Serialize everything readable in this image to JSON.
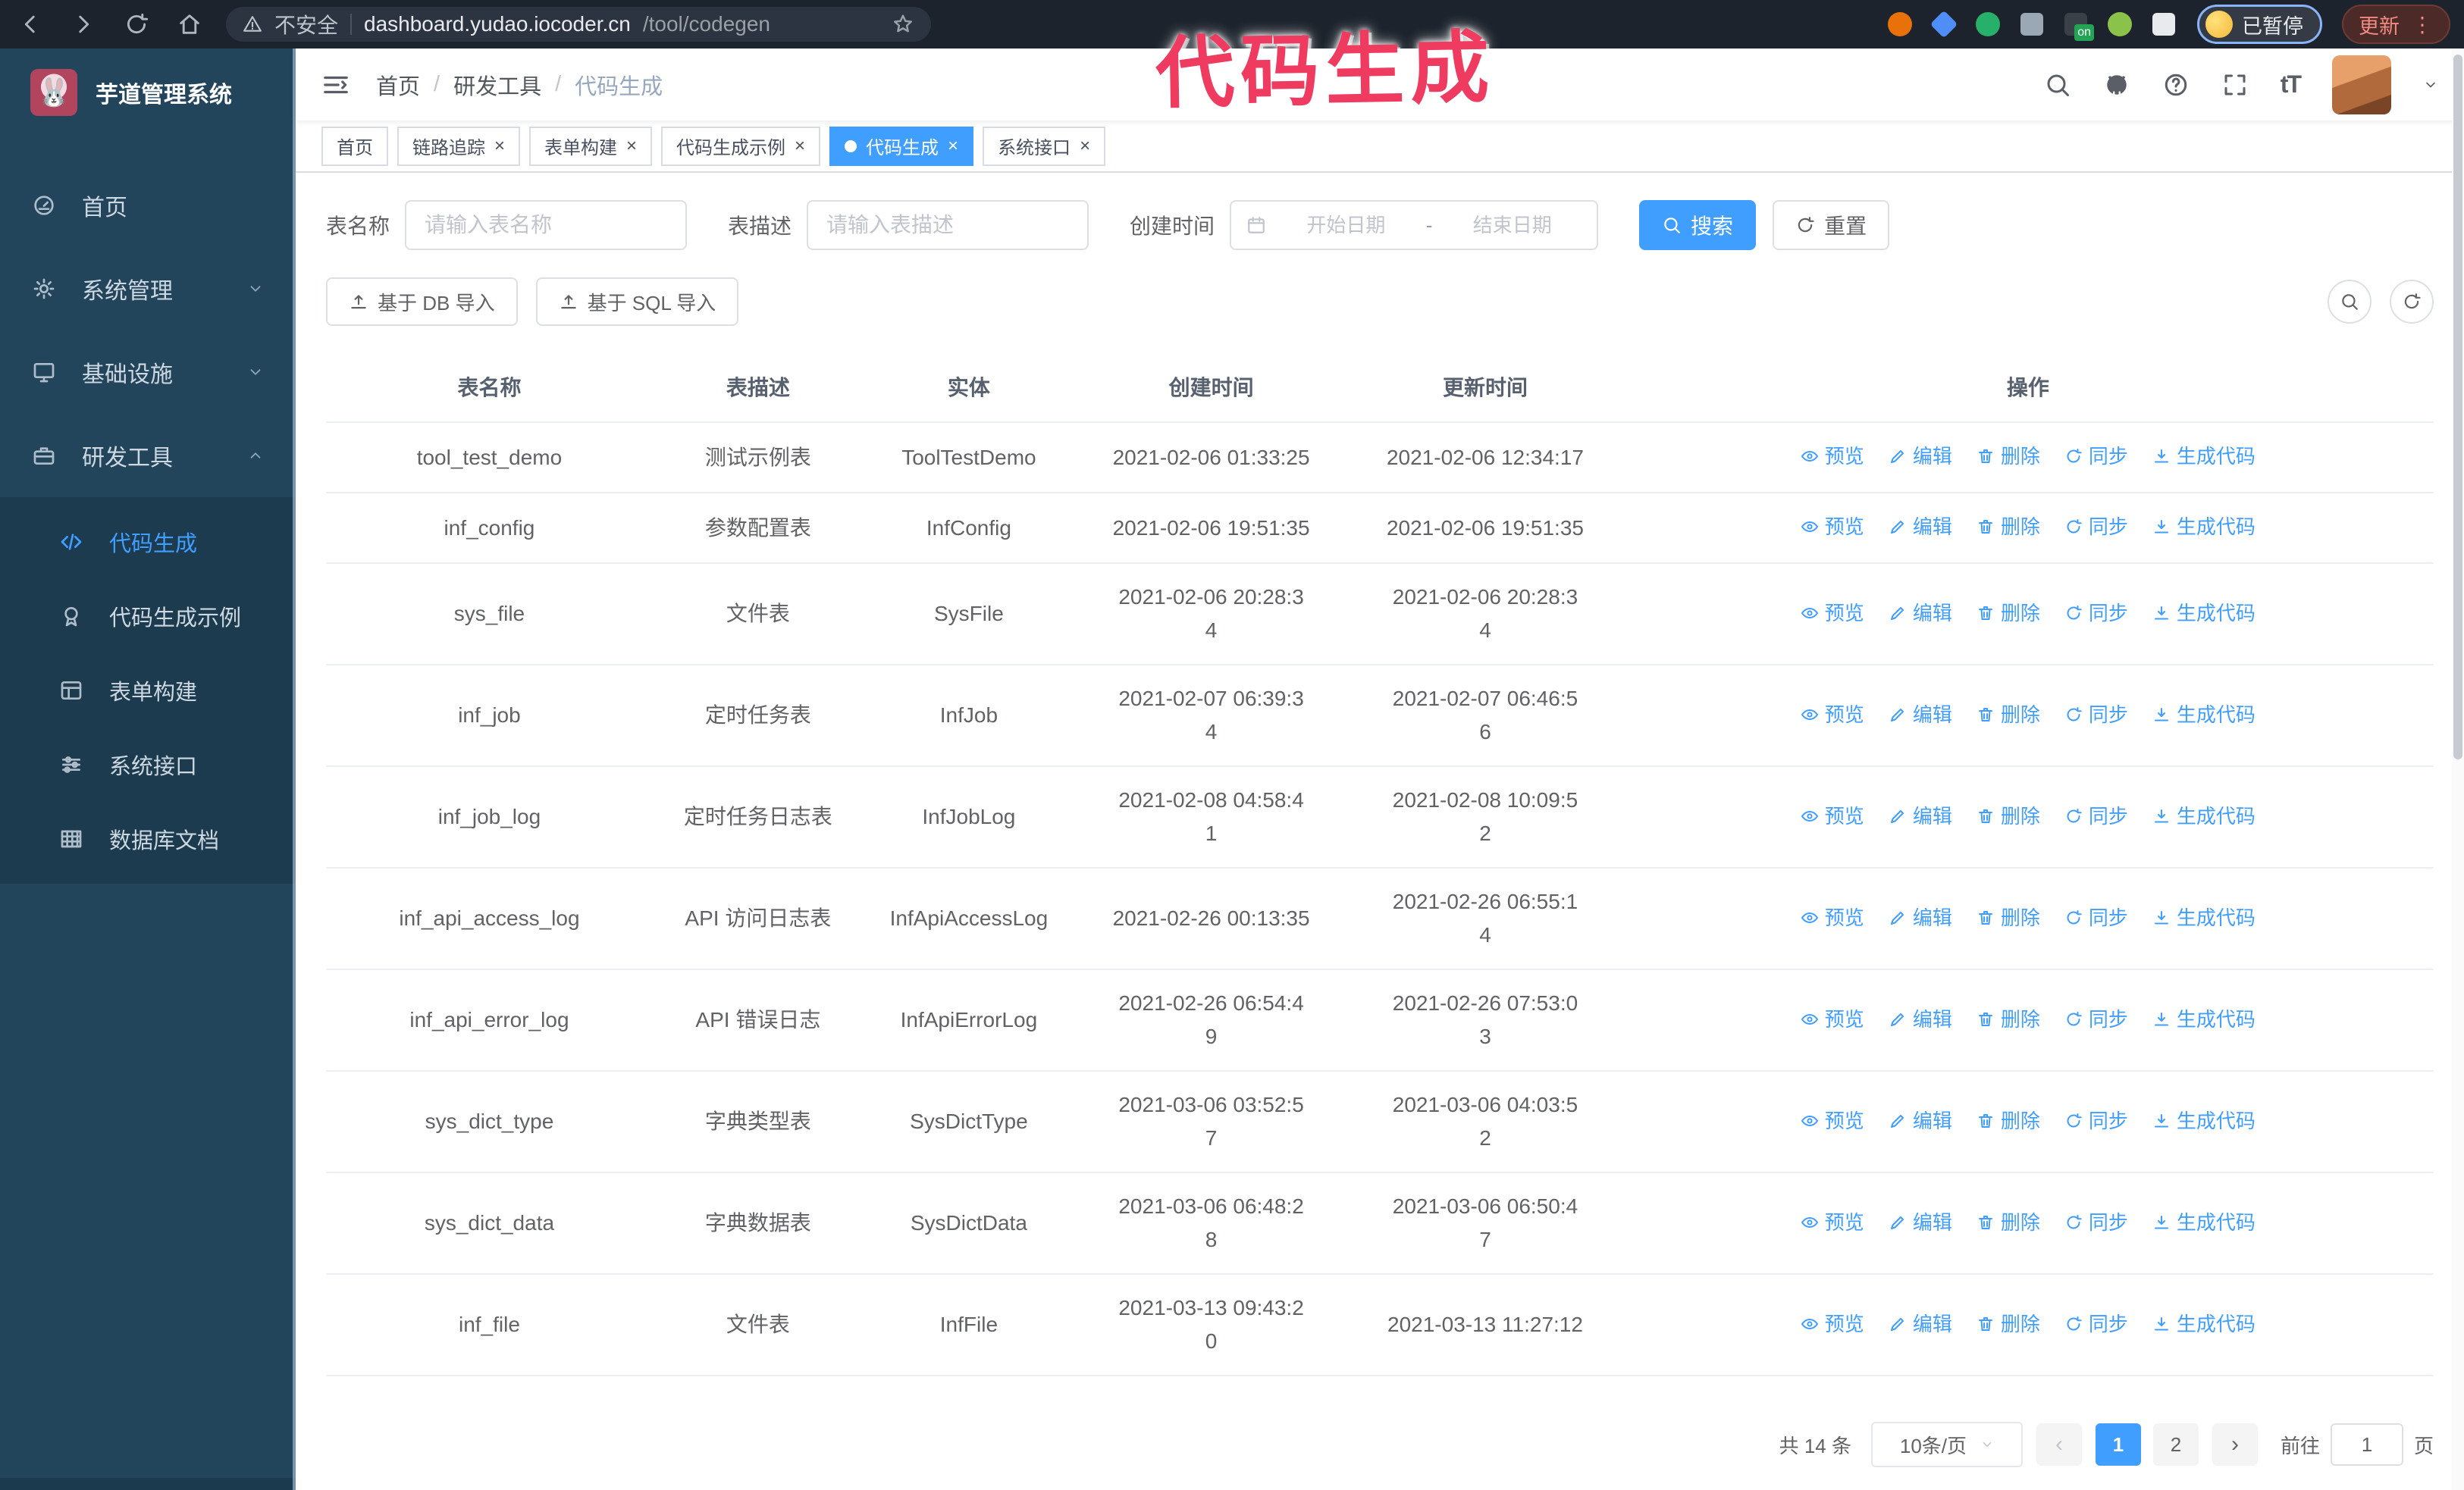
{
  "browser": {
    "security_label": "不安全",
    "url_host": "dashboard.yudao.iocoder.cn",
    "url_path": "/tool/codegen",
    "profile_badge": "已暂停",
    "update_label": "更新",
    "extensions": [
      {
        "shape": "circle",
        "color": "#e8710a"
      },
      {
        "shape": "diamond",
        "color": "#4f8df7"
      },
      {
        "shape": "circle",
        "color": "#27b06a"
      },
      {
        "shape": "grid",
        "color": "#9aa7b5"
      },
      {
        "shape": "square",
        "color": "#3a4047",
        "badge": "on"
      },
      {
        "shape": "circle",
        "color": "#8bc34a"
      },
      {
        "shape": "puzzle",
        "color": "#e8eaed"
      }
    ]
  },
  "annotation": {
    "text": "代码生成",
    "color": "#ee3b5f"
  },
  "sidebar": {
    "title": "芋道管理系统",
    "logo_icon": "rabbit-logo",
    "items": [
      {
        "label": "首页",
        "icon": "dashboard",
        "chevron": ""
      },
      {
        "label": "系统管理",
        "icon": "gear",
        "chevron": "down"
      },
      {
        "label": "基础设施",
        "icon": "monitor",
        "chevron": "down"
      },
      {
        "label": "研发工具",
        "icon": "toolbox",
        "chevron": "up",
        "expanded": true
      }
    ],
    "submenu": [
      {
        "label": "代码生成",
        "icon": "code",
        "active": true
      },
      {
        "label": "代码生成示例",
        "icon": "medal",
        "active": false
      },
      {
        "label": "表单构建",
        "icon": "form",
        "active": false
      },
      {
        "label": "系统接口",
        "icon": "sliders",
        "active": false
      },
      {
        "label": "数据库文档",
        "icon": "database",
        "active": false
      }
    ]
  },
  "breadcrumb": [
    "首页",
    "研发工具",
    "代码生成"
  ],
  "tabs": [
    {
      "label": "首页",
      "closable": false,
      "active": false
    },
    {
      "label": "链路追踪",
      "closable": true,
      "active": false
    },
    {
      "label": "表单构建",
      "closable": true,
      "active": false
    },
    {
      "label": "代码生成示例",
      "closable": true,
      "active": false
    },
    {
      "label": "代码生成",
      "closable": true,
      "active": true
    },
    {
      "label": "系统接口",
      "closable": true,
      "active": false
    }
  ],
  "filters": {
    "table_name_label": "表名称",
    "table_name_placeholder": "请输入表名称",
    "table_desc_label": "表描述",
    "table_desc_placeholder": "请输入表描述",
    "create_time_label": "创建时间",
    "date_start_placeholder": "开始日期",
    "date_separator": "-",
    "date_end_placeholder": "结束日期",
    "search_label": "搜索",
    "reset_label": "重置"
  },
  "toolbar": {
    "import_db_label": "基于 DB 导入",
    "import_sql_label": "基于 SQL 导入"
  },
  "table": {
    "columns": [
      "表名称",
      "表描述",
      "实体",
      "创建时间",
      "更新时间",
      "操作"
    ],
    "actions": [
      "预览",
      "编辑",
      "删除",
      "同步",
      "生成代码"
    ],
    "action_icons": [
      "eye",
      "edit",
      "delete",
      "sync",
      "download"
    ],
    "rows": [
      {
        "name": "tool_test_demo",
        "desc": "测试示例表",
        "entity": "ToolTestDemo",
        "created": "2021-02-06 01:33:25",
        "updated": "2021-02-06 12:34:17"
      },
      {
        "name": "inf_config",
        "desc": "参数配置表",
        "entity": "InfConfig",
        "created": "2021-02-06 19:51:35",
        "updated": "2021-02-06 19:51:35"
      },
      {
        "name": "sys_file",
        "desc": "文件表",
        "entity": "SysFile",
        "created": "2021-02-06 20:28:3\n4",
        "updated": "2021-02-06 20:28:3\n4"
      },
      {
        "name": "inf_job",
        "desc": "定时任务表",
        "entity": "InfJob",
        "created": "2021-02-07 06:39:3\n4",
        "updated": "2021-02-07 06:46:5\n6"
      },
      {
        "name": "inf_job_log",
        "desc": "定时任务日志表",
        "entity": "InfJobLog",
        "created": "2021-02-08 04:58:4\n1",
        "updated": "2021-02-08 10:09:5\n2"
      },
      {
        "name": "inf_api_access_log",
        "desc": "API 访问日志表",
        "entity": "InfApiAccessLog",
        "created": "2021-02-26 00:13:35",
        "updated": "2021-02-26 06:55:1\n4"
      },
      {
        "name": "inf_api_error_log",
        "desc": "API 错误日志",
        "entity": "InfApiErrorLog",
        "created": "2021-02-26 06:54:4\n9",
        "updated": "2021-02-26 07:53:0\n3"
      },
      {
        "name": "sys_dict_type",
        "desc": "字典类型表",
        "entity": "SysDictType",
        "created": "2021-03-06 03:52:5\n7",
        "updated": "2021-03-06 04:03:5\n2"
      },
      {
        "name": "sys_dict_data",
        "desc": "字典数据表",
        "entity": "SysDictData",
        "created": "2021-03-06 06:48:2\n8",
        "updated": "2021-03-06 06:50:4\n7"
      },
      {
        "name": "inf_file",
        "desc": "文件表",
        "entity": "InfFile",
        "created": "2021-03-13 09:43:2\n0",
        "updated": "2021-03-13 11:27:12"
      }
    ]
  },
  "pagination": {
    "total_label": "共 14 条",
    "page_size_label": "10条/页",
    "pages": [
      "1",
      "2"
    ],
    "active_page": "1",
    "prev_symbol": "‹",
    "next_symbol": "›",
    "goto_label": "前往",
    "goto_value": "1",
    "page_suffix": "页"
  },
  "colors": {
    "primary": "#409eff",
    "sidebar_bg": "#23455c",
    "submenu_bg": "#1d3b4f",
    "annotation": "#ee3b5f",
    "chrome_bg": "#1d232c"
  }
}
